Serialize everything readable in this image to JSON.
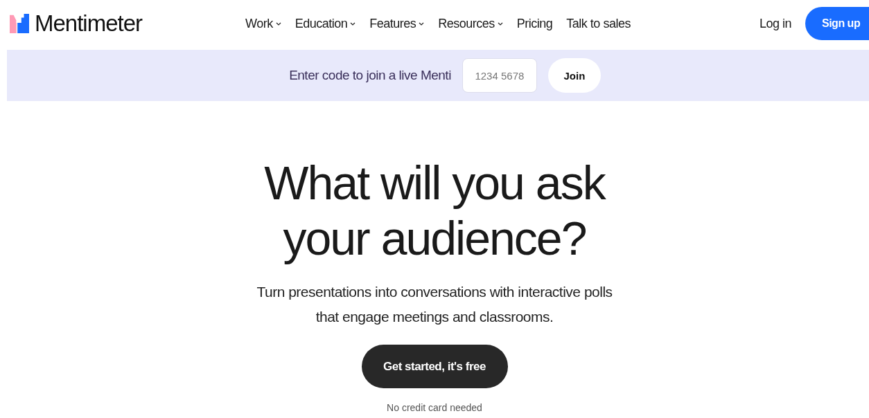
{
  "brand": {
    "name": "Mentimeter"
  },
  "nav": [
    {
      "label": "Work",
      "has_menu": true
    },
    {
      "label": "Education",
      "has_menu": true
    },
    {
      "label": "Features",
      "has_menu": true
    },
    {
      "label": "Resources",
      "has_menu": true
    },
    {
      "label": "Pricing",
      "has_menu": false
    },
    {
      "label": "Talk to sales",
      "has_menu": false
    }
  ],
  "login": "Log in",
  "signup": "Sign up",
  "join_bar": {
    "prompt": "Enter code to join a live Menti",
    "placeholder": "1234 5678",
    "button": "Join"
  },
  "hero": {
    "title_lines": [
      "What will you ask",
      "your audience?"
    ],
    "subtitle_lines": [
      "Turn presentations into conversations with interactive polls",
      "that engage meetings and classrooms."
    ],
    "cta": "Get started, it's free",
    "note": "No credit card needed"
  }
}
